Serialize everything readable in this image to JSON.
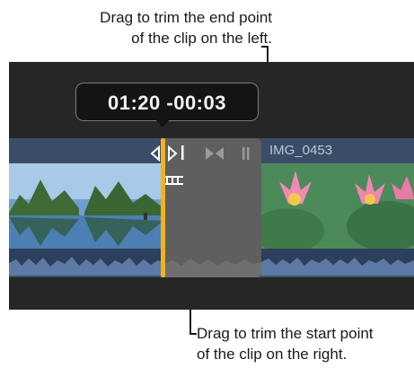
{
  "callouts": {
    "top_line1": "Drag to trim the end point",
    "top_line2": "of the clip on the left.",
    "bottom_line1": "Drag to trim the start point",
    "bottom_line2": "of the clip on the right."
  },
  "timeline": {
    "tooltip_text": "01:20 -00:03",
    "clip_right_name": "IMG_0453"
  },
  "icons": [
    "trim-left-arrow-icon",
    "trim-right-arrow-icon",
    "transition-bowtie-icon",
    "clip-handle-icon",
    "filmstrip-icon"
  ],
  "colors": {
    "accent_edge": "#f2b21b",
    "track_band": "#3b4d66",
    "gap": "#5f5f5f"
  }
}
